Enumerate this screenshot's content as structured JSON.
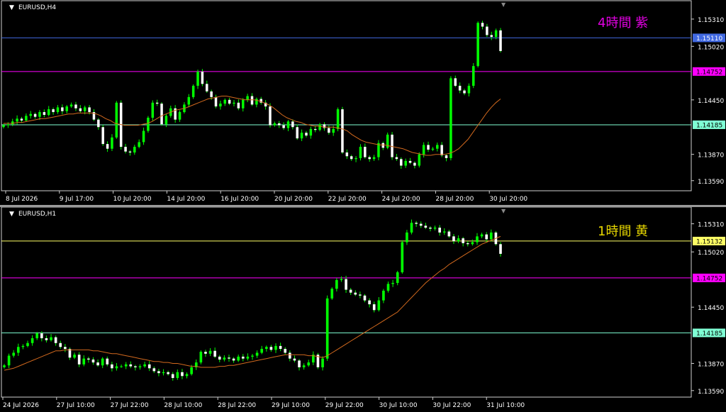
{
  "colors": {
    "background": "#000000",
    "frame": "#cfcfcf",
    "bull": "#00ff00",
    "bear": "#ffffff",
    "ma": "#d2691e",
    "blue_line": "#4169e1",
    "magenta_line": "#ff00ff",
    "teal_line": "#7fffd4",
    "yellow_line": "#ffff66",
    "label_4h": "#e000e0",
    "label_1h": "#e6d600"
  },
  "chart_data": [
    {
      "type": "candlestick",
      "symbol_label": "EURUSD,H4",
      "annotation": "4時間  紫",
      "ylim": [
        1.1349,
        1.154
      ],
      "y_ticks": [
        1.1531,
        1.1502,
        1.1445,
        1.1387,
        1.1359
      ],
      "y_tick_labels": [
        "1.15310",
        "1.15020",
        "1.14450",
        "1.13870",
        "1.13590"
      ],
      "x_labels": [
        "8 Jul 2026",
        "9 Jul 17:00",
        "10 Jul 20:00",
        "14 Jul 20:00",
        "16 Jul 20:00",
        "20 Jul 20:00",
        "22 Jul 20:00",
        "24 Jul 20:00",
        "28 Jul 20:00",
        "30 Jul 20:00"
      ],
      "hlines": [
        {
          "price": 1.1511,
          "label": "1.15110",
          "color": "#4169e1",
          "label_text_color": "#ffffff"
        },
        {
          "price": 1.14752,
          "label": "1.14752",
          "color": "#ff00ff",
          "label_text_color": "#000000"
        },
        {
          "price": 1.14185,
          "label": "1.14185",
          "color": "#7fffd4",
          "label_text_color": "#000000"
        }
      ],
      "close": [
        1.1418,
        1.1419,
        1.1422,
        1.1425,
        1.1423,
        1.1428,
        1.143,
        1.1427,
        1.1432,
        1.1429,
        1.1435,
        1.1432,
        1.1437,
        1.1433,
        1.1438,
        1.144,
        1.1436,
        1.1433,
        1.1437,
        1.1432,
        1.1424,
        1.1416,
        1.1398,
        1.1393,
        1.1405,
        1.1442,
        1.1395,
        1.139,
        1.1389,
        1.1395,
        1.14,
        1.1412,
        1.1426,
        1.1442,
        1.1441,
        1.1419,
        1.1428,
        1.1436,
        1.1424,
        1.1432,
        1.144,
        1.1448,
        1.146,
        1.1475,
        1.1462,
        1.1454,
        1.1448,
        1.1438,
        1.1441,
        1.1445,
        1.1441,
        1.1442,
        1.1436,
        1.1445,
        1.1449,
        1.144,
        1.1446,
        1.1442,
        1.1438,
        1.1418,
        1.142,
        1.1418,
        1.1415,
        1.1422,
        1.1416,
        1.1404,
        1.141,
        1.1407,
        1.1414,
        1.1413,
        1.1419,
        1.1415,
        1.141,
        1.1414,
        1.1435,
        1.1389,
        1.1385,
        1.1382,
        1.1383,
        1.1395,
        1.1384,
        1.1382,
        1.1384,
        1.1399,
        1.1394,
        1.1408,
        1.1384,
        1.1382,
        1.1375,
        1.138,
        1.1378,
        1.1375,
        1.1387,
        1.1397,
        1.1392,
        1.1393,
        1.1397,
        1.1386,
        1.1383,
        1.1468,
        1.146,
        1.1455,
        1.1452,
        1.146,
        1.1481,
        1.1527,
        1.1523,
        1.1514,
        1.1512,
        1.1519,
        1.1497
      ],
      "ma": [
        1.142,
        1.142,
        1.142,
        1.1421,
        1.1421,
        1.1422,
        1.1423,
        1.1424,
        1.1425,
        1.1425,
        1.1426,
        1.1427,
        1.1428,
        1.1429,
        1.143,
        1.143,
        1.1431,
        1.1431,
        1.1431,
        1.1431,
        1.143,
        1.1428,
        1.1425,
        1.1423,
        1.142,
        1.1419,
        1.1418,
        1.1418,
        1.1418,
        1.1418,
        1.1419,
        1.142,
        1.1422,
        1.1425,
        1.1428,
        1.143,
        1.1432,
        1.1434,
        1.1435,
        1.1436,
        1.1438,
        1.144,
        1.1442,
        1.1444,
        1.1446,
        1.1447,
        1.1448,
        1.1449,
        1.1449,
        1.1448,
        1.1447,
        1.1446,
        1.1445,
        1.1445,
        1.1445,
        1.1444,
        1.1442,
        1.144,
        1.1437,
        1.1433,
        1.1429,
        1.1426,
        1.1424,
        1.1422,
        1.1421,
        1.1419,
        1.1418,
        1.1417,
        1.1417,
        1.1416,
        1.1416,
        1.1416,
        1.1415,
        1.1414,
        1.1412,
        1.1408,
        1.1405,
        1.1402,
        1.14,
        1.1399,
        1.1398,
        1.1397,
        1.1397,
        1.1396,
        1.1395,
        1.1394,
        1.1393,
        1.1391,
        1.1389,
        1.1388,
        1.1387,
        1.1386,
        1.1386,
        1.1387,
        1.1387,
        1.1387,
        1.1388,
        1.139,
        1.1393,
        1.1398,
        1.1403,
        1.141,
        1.1417,
        1.1424,
        1.1431,
        1.1437,
        1.1442,
        1.1446
      ]
    },
    {
      "type": "candlestick",
      "symbol_label": "EURUSD,H1",
      "annotation": "1時間  黄",
      "ylim": [
        1.1353,
        1.1538
      ],
      "y_ticks": [
        1.1531,
        1.1502,
        1.1445,
        1.1387,
        1.1359
      ],
      "y_tick_labels": [
        "1.15310",
        "1.15020",
        "1.14450",
        "1.13870",
        "1.13590"
      ],
      "x_labels": [
        "24 Jul 2026",
        "27 Jul 10:00",
        "27 Jul 22:00",
        "28 Jul 10:00",
        "28 Jul 22:00",
        "29 Jul 10:00",
        "29 Jul 22:00",
        "30 Jul 10:00",
        "30 Jul 22:00",
        "31 Jul 10:00"
      ],
      "hlines": [
        {
          "price": 1.15132,
          "label": "1.15132",
          "color": "#ffff66",
          "label_text_color": "#000000"
        },
        {
          "price": 1.14752,
          "label": "1.14752",
          "color": "#ff00ff",
          "label_text_color": "#000000"
        },
        {
          "price": 1.14185,
          "label": "1.14185",
          "color": "#7fffd4",
          "label_text_color": "#000000"
        }
      ],
      "close": [
        1.1385,
        1.1395,
        1.1398,
        1.1404,
        1.1405,
        1.1408,
        1.1413,
        1.1418,
        1.1413,
        1.1411,
        1.1414,
        1.1408,
        1.1404,
        1.1402,
        1.1393,
        1.1396,
        1.1386,
        1.1392,
        1.1391,
        1.1388,
        1.1385,
        1.1392,
        1.1386,
        1.1382,
        1.1384,
        1.1384,
        1.1386,
        1.1384,
        1.1383,
        1.1384,
        1.1386,
        1.1382,
        1.1379,
        1.1377,
        1.1378,
        1.1376,
        1.1372,
        1.1378,
        1.1374,
        1.1376,
        1.1383,
        1.1388,
        1.1399,
        1.1397,
        1.14,
        1.1394,
        1.1391,
        1.1393,
        1.1392,
        1.139,
        1.1394,
        1.1392,
        1.1394,
        1.1395,
        1.1398,
        1.1402,
        1.1404,
        1.1401,
        1.1405,
        1.1402,
        1.1398,
        1.1392,
        1.139,
        1.1383,
        1.1385,
        1.1388,
        1.1396,
        1.1383,
        1.1392,
        1.1454,
        1.1464,
        1.1473,
        1.1474,
        1.1463,
        1.146,
        1.1458,
        1.1457,
        1.1452,
        1.1448,
        1.1442,
        1.1452,
        1.1462,
        1.1469,
        1.147,
        1.1481,
        1.1512,
        1.1522,
        1.1532,
        1.1531,
        1.1529,
        1.1527,
        1.1526,
        1.1527,
        1.1522,
        1.1523,
        1.1518,
        1.1513,
        1.1516,
        1.1511,
        1.151,
        1.1512,
        1.1518,
        1.152,
        1.1515,
        1.1522,
        1.151,
        1.15
      ],
      "ma": [
        1.138,
        1.1381,
        1.1382,
        1.1384,
        1.1386,
        1.1388,
        1.139,
        1.1392,
        1.1394,
        1.1396,
        1.1398,
        1.14,
        1.14,
        1.1401,
        1.1401,
        1.1401,
        1.1401,
        1.1401,
        1.1401,
        1.14,
        1.14,
        1.1399,
        1.1398,
        1.1397,
        1.1397,
        1.1396,
        1.1395,
        1.1394,
        1.1393,
        1.1392,
        1.1391,
        1.139,
        1.1389,
        1.1389,
        1.1388,
        1.1388,
        1.1387,
        1.1387,
        1.1386,
        1.1385,
        1.1384,
        1.1384,
        1.1383,
        1.1383,
        1.1383,
        1.1383,
        1.1384,
        1.1384,
        1.1385,
        1.1385,
        1.1386,
        1.1387,
        1.1388,
        1.1389,
        1.139,
        1.1391,
        1.1392,
        1.1393,
        1.1394,
        1.1395,
        1.1396,
        1.1396,
        1.1396,
        1.1396,
        1.1396,
        1.1395,
        1.1395,
        1.1394,
        1.1393,
        1.1395,
        1.1398,
        1.1401,
        1.1404,
        1.1407,
        1.141,
        1.1413,
        1.1416,
        1.1419,
        1.1422,
        1.1425,
        1.1428,
        1.1431,
        1.1434,
        1.1437,
        1.144,
        1.1445,
        1.145,
        1.1455,
        1.146,
        1.1465,
        1.147,
        1.1474,
        1.1478,
        1.1482,
        1.1485,
        1.1489,
        1.1492,
        1.1495,
        1.1498,
        1.1501,
        1.1504,
        1.1507,
        1.151,
        1.1512,
        1.1514,
        1.1516,
        1.1518
      ]
    }
  ]
}
